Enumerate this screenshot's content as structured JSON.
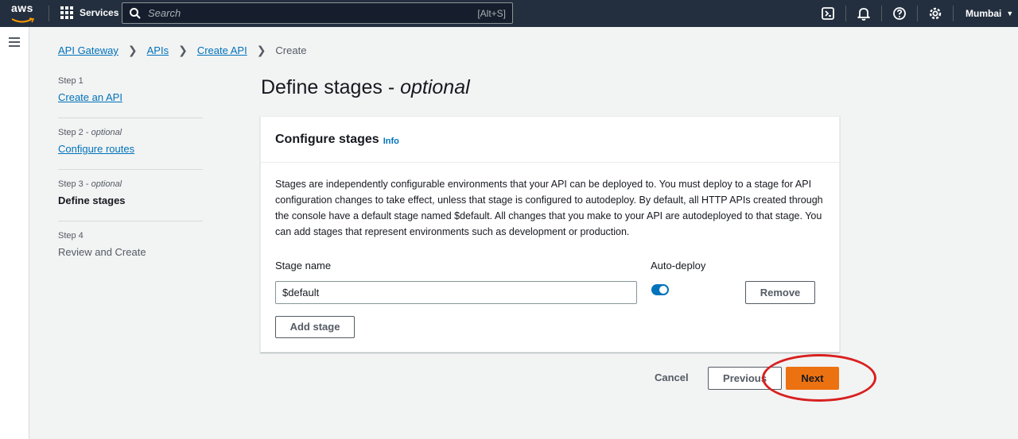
{
  "topnav": {
    "logo_text": "aws",
    "services_label": "Services",
    "search_placeholder": "Search",
    "search_shortcut": "[Alt+S]",
    "region_label": "Mumbai"
  },
  "breadcrumb": {
    "items": [
      "API Gateway",
      "APIs",
      "Create API"
    ],
    "current": "Create"
  },
  "steps": [
    {
      "number": "Step 1",
      "optional": "",
      "title": "Create an API"
    },
    {
      "number": "Step 2",
      "optional": "optional",
      "title": "Configure routes"
    },
    {
      "number": "Step 3",
      "optional": "optional",
      "title": "Define stages"
    },
    {
      "number": "Step 4",
      "optional": "",
      "title": "Review and Create"
    }
  ],
  "page": {
    "title": "Define stages - ",
    "title_italic": "optional"
  },
  "card": {
    "heading": "Configure stages",
    "info_link": "Info",
    "description": "Stages are independently configurable environments that your API can be deployed to. You must deploy to a stage for API configuration changes to take effect, unless that stage is configured to autodeploy. By default, all HTTP APIs created through the console have a default stage named $default. All changes that you make to your API are autodeployed to that stage. You can add stages that represent environments such as development or production.",
    "stage_name_label": "Stage name",
    "auto_deploy_label": "Auto-deploy",
    "stage_name_value": "$default",
    "auto_deploy_on": true,
    "remove_label": "Remove",
    "add_stage_label": "Add stage"
  },
  "footer": {
    "cancel_label": "Cancel",
    "previous_label": "Previous",
    "next_label": "Next"
  },
  "colors": {
    "nav_bg": "#232f3e",
    "link": "#0073bb",
    "primary": "#ec7211",
    "annotation": "#d8201f"
  }
}
